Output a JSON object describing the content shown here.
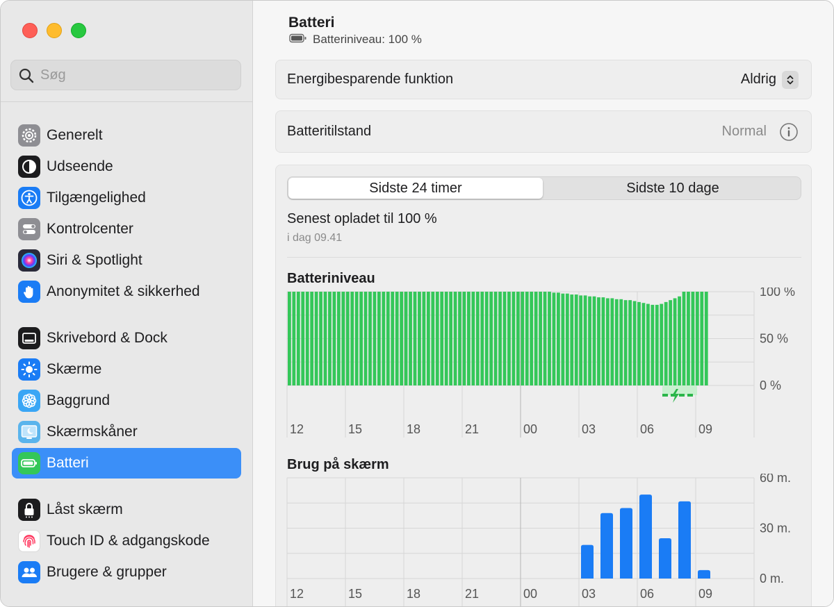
{
  "window": {
    "traffic_lights": [
      "close",
      "minimize",
      "zoom"
    ]
  },
  "search": {
    "placeholder": "Søg"
  },
  "sidebar": {
    "items": [
      {
        "label": "Generelt",
        "icon": "gear-icon",
        "color": "#8e8e93"
      },
      {
        "label": "Udseende",
        "icon": "appearance-icon",
        "color": "#1c1c1e"
      },
      {
        "label": "Tilgængelighed",
        "icon": "accessibility-icon",
        "color": "#1a7cf5"
      },
      {
        "label": "Kontrolcenter",
        "icon": "control-center-icon",
        "color": "#8e8e93"
      },
      {
        "label": "Siri & Spotlight",
        "icon": "siri-icon",
        "color": "#2a2a3a"
      },
      {
        "label": "Anonymitet & sikkerhed",
        "icon": "hand-icon",
        "color": "#1a7cf5"
      },
      {
        "label": "Skrivebord & Dock",
        "icon": "dock-icon",
        "color": "#1c1c1e"
      },
      {
        "label": "Skærme",
        "icon": "sun-icon",
        "color": "#1a7cf5"
      },
      {
        "label": "Baggrund",
        "icon": "flower-icon",
        "color": "#3aa6f5"
      },
      {
        "label": "Skærmskåner",
        "icon": "screensaver-icon",
        "color": "#5ab4ec"
      },
      {
        "label": "Batteri",
        "icon": "battery-icon",
        "color": "#34c759",
        "active": true
      },
      {
        "label": "Låst skærm",
        "icon": "lock-icon",
        "color": "#1c1c1e"
      },
      {
        "label": "Touch ID & adgangskode",
        "icon": "fingerprint-icon",
        "color": "#ffffff"
      },
      {
        "label": "Brugere & grupper",
        "icon": "users-icon",
        "color": "#1a7cf5"
      }
    ]
  },
  "header": {
    "title": "Batteri",
    "subtitle": "Batteriniveau: 100 %"
  },
  "energy_row": {
    "label": "Energibesparende funktion",
    "value": "Aldrig"
  },
  "health_row": {
    "label": "Batteritilstand",
    "value": "Normal"
  },
  "tabs": [
    {
      "label": "Sidste 24 timer",
      "selected": true
    },
    {
      "label": "Sidste 10 dage",
      "selected": false
    }
  ],
  "last_charged": {
    "title": "Senest opladet til 100 %",
    "time": "i dag 09.41"
  },
  "chart_data": [
    {
      "type": "bar",
      "title": "Batteriniveau",
      "unit": "%",
      "x_ticks": [
        "12",
        "15",
        "18",
        "21",
        "00",
        "03",
        "06",
        "09"
      ],
      "y_ticks": [
        "100 %",
        "50 %",
        "0 %"
      ],
      "ylim": [
        0,
        100
      ],
      "values": [
        100,
        100,
        100,
        100,
        100,
        100,
        100,
        100,
        100,
        100,
        100,
        100,
        100,
        100,
        100,
        100,
        100,
        100,
        100,
        100,
        100,
        100,
        100,
        100,
        100,
        100,
        100,
        100,
        100,
        100,
        100,
        100,
        100,
        100,
        100,
        100,
        100,
        100,
        100,
        100,
        100,
        100,
        100,
        100,
        100,
        100,
        100,
        100,
        100,
        100,
        100,
        100,
        100,
        100,
        100,
        100,
        100,
        100,
        100,
        99,
        99,
        98,
        98,
        97,
        97,
        96,
        96,
        95,
        95,
        94,
        94,
        93,
        93,
        92,
        92,
        91,
        91,
        90,
        89,
        88,
        87,
        86,
        86,
        87,
        89,
        91,
        93,
        95,
        100,
        100,
        100,
        100,
        100,
        100
      ],
      "charging_indicator": true,
      "bar_color": "#34c759",
      "charging_color": "#c8f0cf"
    },
    {
      "type": "bar",
      "title": "Brug på skærm",
      "unit": "m.",
      "x_ticks": [
        "12",
        "15",
        "18",
        "21",
        "00",
        "03",
        "06",
        "09"
      ],
      "y_ticks": [
        "60 m.",
        "30 m.",
        "0 m."
      ],
      "ylim": [
        0,
        60
      ],
      "bars": [
        {
          "hour": 4,
          "value": 20
        },
        {
          "hour": 5,
          "value": 39
        },
        {
          "hour": 6,
          "value": 42
        },
        {
          "hour": 7,
          "value": 50
        },
        {
          "hour": 8,
          "value": 24
        },
        {
          "hour": 9,
          "value": 46
        },
        {
          "hour": 10,
          "value": 5
        }
      ],
      "bar_color": "#1a7cf5"
    }
  ]
}
